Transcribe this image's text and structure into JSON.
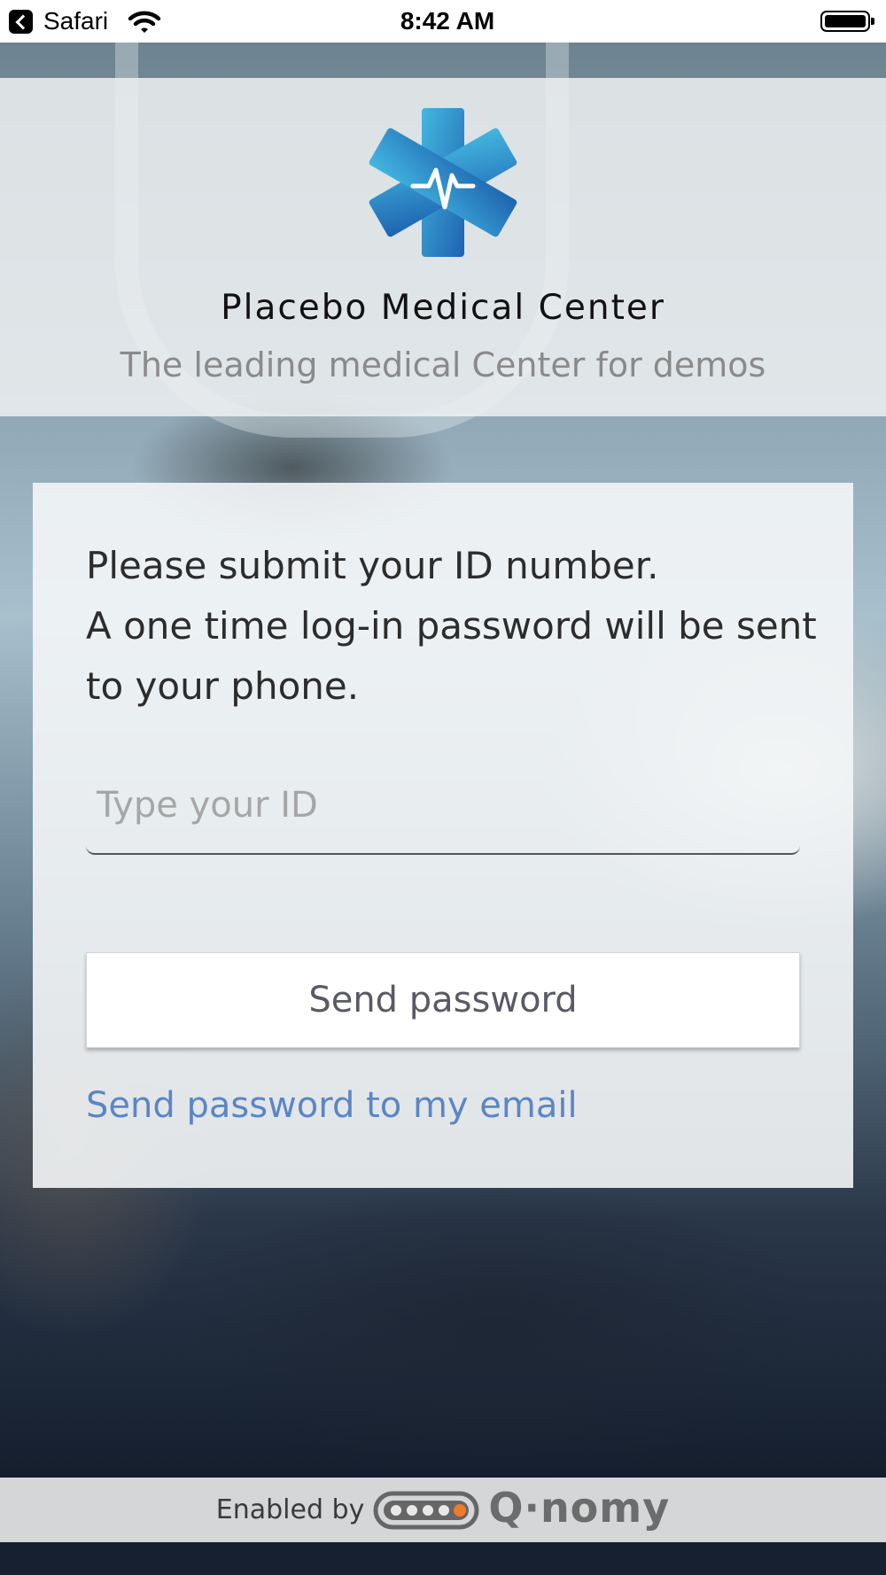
{
  "status_bar": {
    "back_app": "Safari",
    "time": "8:42 AM"
  },
  "header": {
    "logo_icon": "medical-star-of-life-heartbeat",
    "title": "Placebo Medical Center",
    "subtitle": "The leading medical Center for demos"
  },
  "form": {
    "instructions": [
      "Please submit your ID number.",
      "A one time log-in password will be sent",
      "to your phone."
    ],
    "id_input": {
      "placeholder": "Type your ID",
      "value": ""
    },
    "send_button_label": "Send password",
    "email_link_label": "Send password to my email"
  },
  "footer": {
    "enabled_by": "Enabled by",
    "brand": "Q·nomy"
  },
  "colors": {
    "logo_blue": "#2f8fd0",
    "link": "#5b86c4",
    "brand_orange": "#f07a2a"
  }
}
